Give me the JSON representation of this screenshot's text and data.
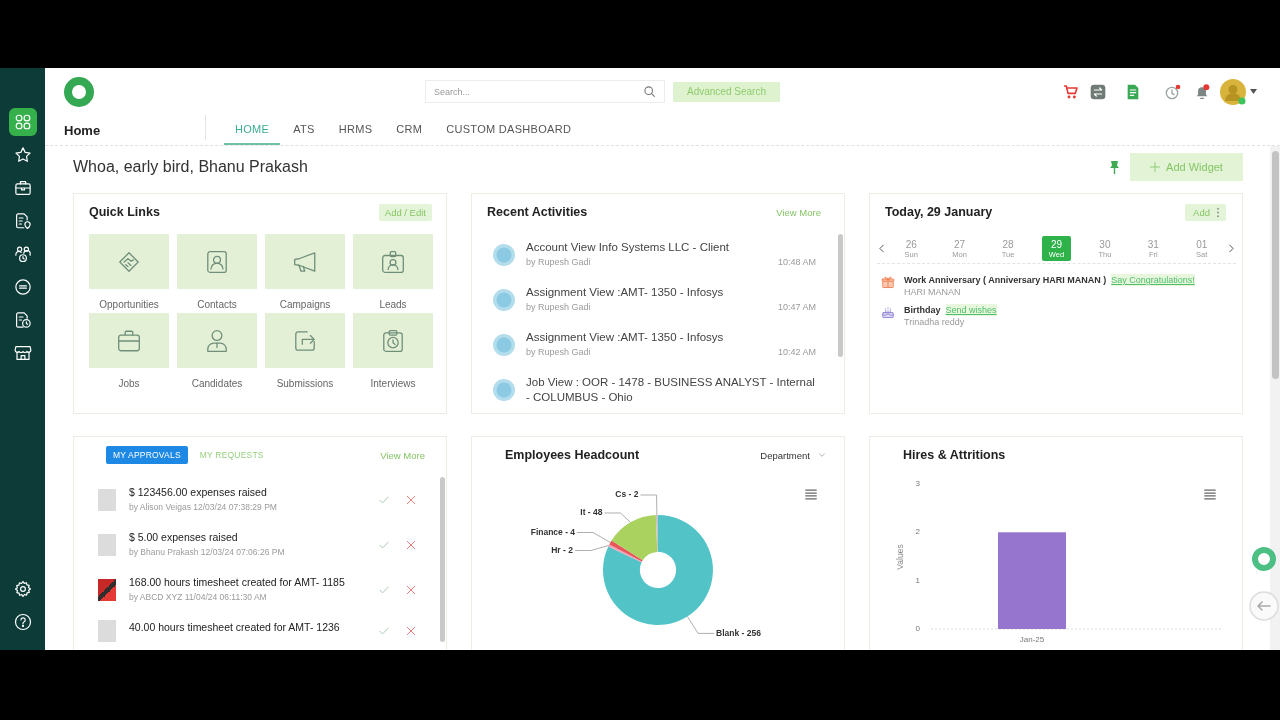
{
  "sidebar": {
    "items": [
      {
        "selected": true
      },
      {
        "selected": false
      },
      {
        "selected": false
      },
      {
        "selected": false
      },
      {
        "selected": false
      },
      {
        "selected": false
      },
      {
        "selected": false
      },
      {
        "selected": false
      }
    ]
  },
  "header": {
    "search": {
      "placeholder": "Search..."
    },
    "advanced_search": "Advanced Search"
  },
  "nav": {
    "page_title": "Home",
    "tabs": [
      {
        "label": "HOME",
        "selected": true
      },
      {
        "label": "ATS",
        "selected": false
      },
      {
        "label": "HRMS",
        "selected": false
      },
      {
        "label": "CRM",
        "selected": false
      },
      {
        "label": "CUSTOM DASHBOARD",
        "selected": false
      }
    ]
  },
  "greeting": {
    "text": "Whoa, early bird, Bhanu Prakash",
    "add_widget": "Add Widget"
  },
  "quick_links": {
    "title": "Quick Links",
    "action": "Add / Edit",
    "items": [
      {
        "label": "Opportunities"
      },
      {
        "label": "Contacts"
      },
      {
        "label": "Campaigns"
      },
      {
        "label": "Leads"
      },
      {
        "label": "Jobs"
      },
      {
        "label": "Candidates"
      },
      {
        "label": "Submissions"
      },
      {
        "label": "Interviews"
      }
    ]
  },
  "recent_activities": {
    "title": "Recent Activities",
    "action": "View More",
    "items": [
      {
        "title": "Account View Info Systems LLC - Client",
        "by": "by Rupesh Gadi",
        "time": "10:48 AM"
      },
      {
        "title": "Assignment View :AMT- 1350 - Infosys",
        "by": "by Rupesh Gadi",
        "time": "10:47 AM"
      },
      {
        "title": "Assignment View :AMT- 1350 - Infosys",
        "by": "by Rupesh Gadi",
        "time": "10:42 AM"
      },
      {
        "title": "Job View : OOR - 1478 - BUSINESS ANALYST - Internal - COLUMBUS - Ohio"
      }
    ]
  },
  "today": {
    "title": "Today, 29 January",
    "action": "Add",
    "days": [
      {
        "date": "26",
        "weekday": "Sun",
        "selected": false
      },
      {
        "date": "27",
        "weekday": "Mon",
        "selected": false
      },
      {
        "date": "28",
        "weekday": "Tue",
        "selected": false
      },
      {
        "date": "29",
        "weekday": "Wed",
        "selected": true
      },
      {
        "date": "30",
        "weekday": "Thu",
        "selected": false
      },
      {
        "date": "31",
        "weekday": "Fri",
        "selected": false
      },
      {
        "date": "01",
        "weekday": "Sat",
        "selected": false
      }
    ],
    "events": [
      {
        "kind": "anniversary",
        "title": "Work Anniversary ( Anniversary HARI MANAN )",
        "link": "Say Congratulations!",
        "person": "HARI MANAN"
      },
      {
        "kind": "birthday",
        "title": "Birthday",
        "link": "Send wishes",
        "person": "Trinadha reddy"
      }
    ]
  },
  "approvals": {
    "tabs": [
      {
        "label": "MY APPROVALS",
        "selected": true
      },
      {
        "label": "MY REQUESTS",
        "selected": false
      }
    ],
    "action": "View More",
    "items": [
      {
        "kind": "blank",
        "title": "$ 123456.00 expenses raised",
        "by": "by Alison Veigas 12/03/24 07:38:29 PM"
      },
      {
        "kind": "blank",
        "title": "$ 5.00 expenses raised",
        "by": "by Bhanu Prakash 12/03/24 07:06:26 PM"
      },
      {
        "kind": "logo",
        "title": "168.00 hours timesheet created for AMT- 1185",
        "by": "by ABCD XYZ 11/04/24 06:11:30 AM"
      },
      {
        "kind": "blank",
        "title": "40.00 hours timesheet created for AMT- 1236"
      }
    ]
  },
  "headcount": {
    "title": "Employees Headcount",
    "filter": "Department",
    "chart_data": {
      "type": "donut",
      "categories": [
        "Blank - 256",
        "Hr - 2",
        "Finance - 4",
        "It - 48",
        "Cs - 2"
      ],
      "values": [
        82.06,
        0.64,
        1.28,
        15.38,
        0.64
      ]
    }
  },
  "hires": {
    "title": "Hires & Attritions",
    "chart_data": {
      "type": "bar",
      "categories": [
        "Jan-25"
      ],
      "ylabel": "Values",
      "ylim": [
        0,
        3
      ],
      "yticks": [
        0,
        1,
        2,
        3
      ],
      "series": [
        {
          "color": "#9575cd",
          "values": [
            2
          ]
        }
      ]
    }
  }
}
